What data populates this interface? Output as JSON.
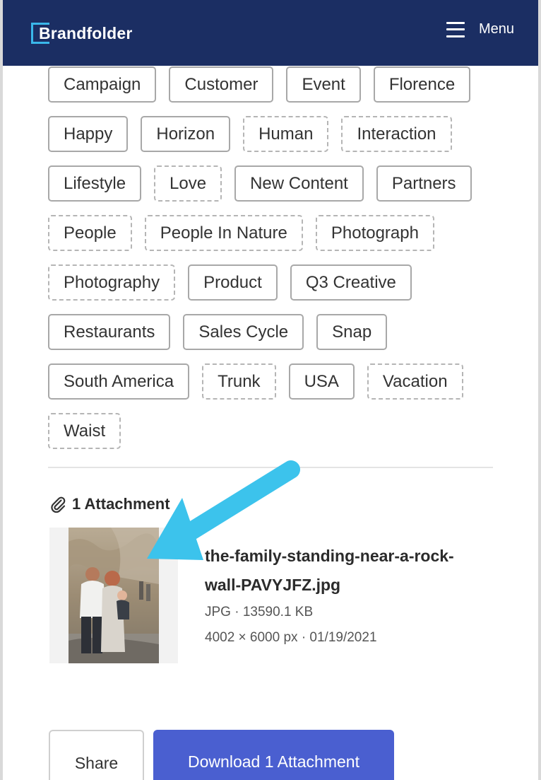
{
  "header": {
    "logo_text": "Brandfolder",
    "menu_label": "Menu",
    "colors": {
      "background": "#1b2e63",
      "logo_accent": "#3ab7ea"
    }
  },
  "tags": [
    {
      "label": "Campaign",
      "style": "solid"
    },
    {
      "label": "Customer",
      "style": "solid"
    },
    {
      "label": "Event",
      "style": "solid"
    },
    {
      "label": "Florence",
      "style": "solid"
    },
    {
      "label": "Happy",
      "style": "solid"
    },
    {
      "label": "Horizon",
      "style": "solid"
    },
    {
      "label": "Human",
      "style": "dashed"
    },
    {
      "label": "Interaction",
      "style": "dashed"
    },
    {
      "label": "Lifestyle",
      "style": "solid"
    },
    {
      "label": "Love",
      "style": "dashed"
    },
    {
      "label": "New Content",
      "style": "solid"
    },
    {
      "label": "Partners",
      "style": "solid"
    },
    {
      "label": "People",
      "style": "dashed"
    },
    {
      "label": "People In Nature",
      "style": "dashed"
    },
    {
      "label": "Photograph",
      "style": "dashed"
    },
    {
      "label": "Photography",
      "style": "dashed"
    },
    {
      "label": "Product",
      "style": "solid"
    },
    {
      "label": "Q3 Creative",
      "style": "solid"
    },
    {
      "label": "Restaurants",
      "style": "solid"
    },
    {
      "label": "Sales Cycle",
      "style": "solid"
    },
    {
      "label": "Snap",
      "style": "solid"
    },
    {
      "label": "South America",
      "style": "solid"
    },
    {
      "label": "Trunk",
      "style": "dashed"
    },
    {
      "label": "USA",
      "style": "solid"
    },
    {
      "label": "Vacation",
      "style": "dashed"
    },
    {
      "label": "Waist",
      "style": "dashed"
    }
  ],
  "attachments": {
    "heading": "1 Attachment",
    "icon": "paperclip-icon",
    "file": {
      "name": "the-family-standing-near-a-rock-wall-PAVYJFZ.jpg",
      "type_size": "JPG · 13590.1 KB",
      "dims_date": "4002 × 6000 px · 01/19/2021"
    }
  },
  "annotation": {
    "icon": "arrow-pointer-icon",
    "color": "#3cc3ec"
  },
  "actions": {
    "share_label": "Share",
    "download_label": "Download 1 Attachment",
    "download_color": "#4a5fd0"
  }
}
